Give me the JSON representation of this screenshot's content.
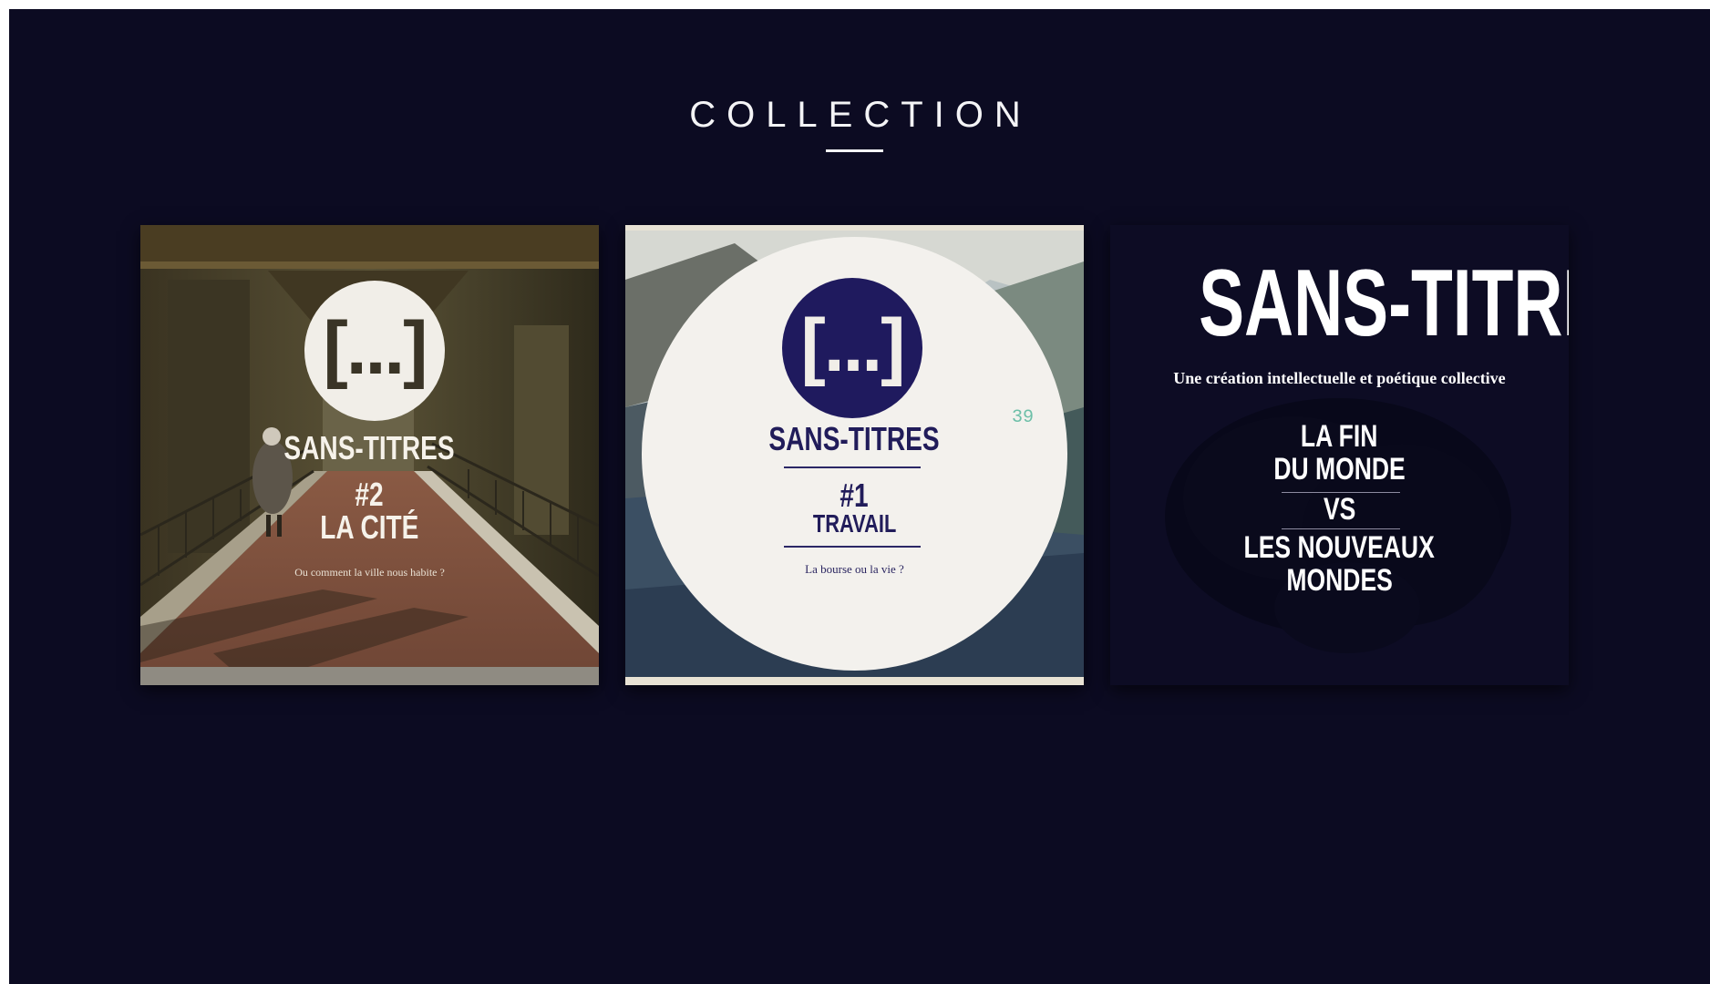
{
  "page": {
    "heading": "COLLECTION"
  },
  "colors": {
    "background": "#0c0b22",
    "heading": "#f4f4f6",
    "brand_blue": "#1f1a5e"
  },
  "covers": [
    {
      "logo": "[...]",
      "brand": "SANS-TITRES",
      "issue_number": "#2",
      "issue_title": "LA CITÉ",
      "tagline": "Ou comment la ville nous habite ?"
    },
    {
      "logo": "[...]",
      "brand": "SANS-TITRES",
      "issue_number": "#1",
      "issue_title": "TRAVAIL",
      "tagline": "La bourse ou la vie ?",
      "page_number": "39"
    },
    {
      "brand": "SANS-TITRES",
      "subtitle": "Une création intellectuelle et poétique collective",
      "title_line_1": "LA FIN",
      "title_line_2": "DU MONDE",
      "versus": "VS",
      "title_line_3": "LES NOUVEAUX",
      "title_line_4": "MONDES"
    }
  ]
}
